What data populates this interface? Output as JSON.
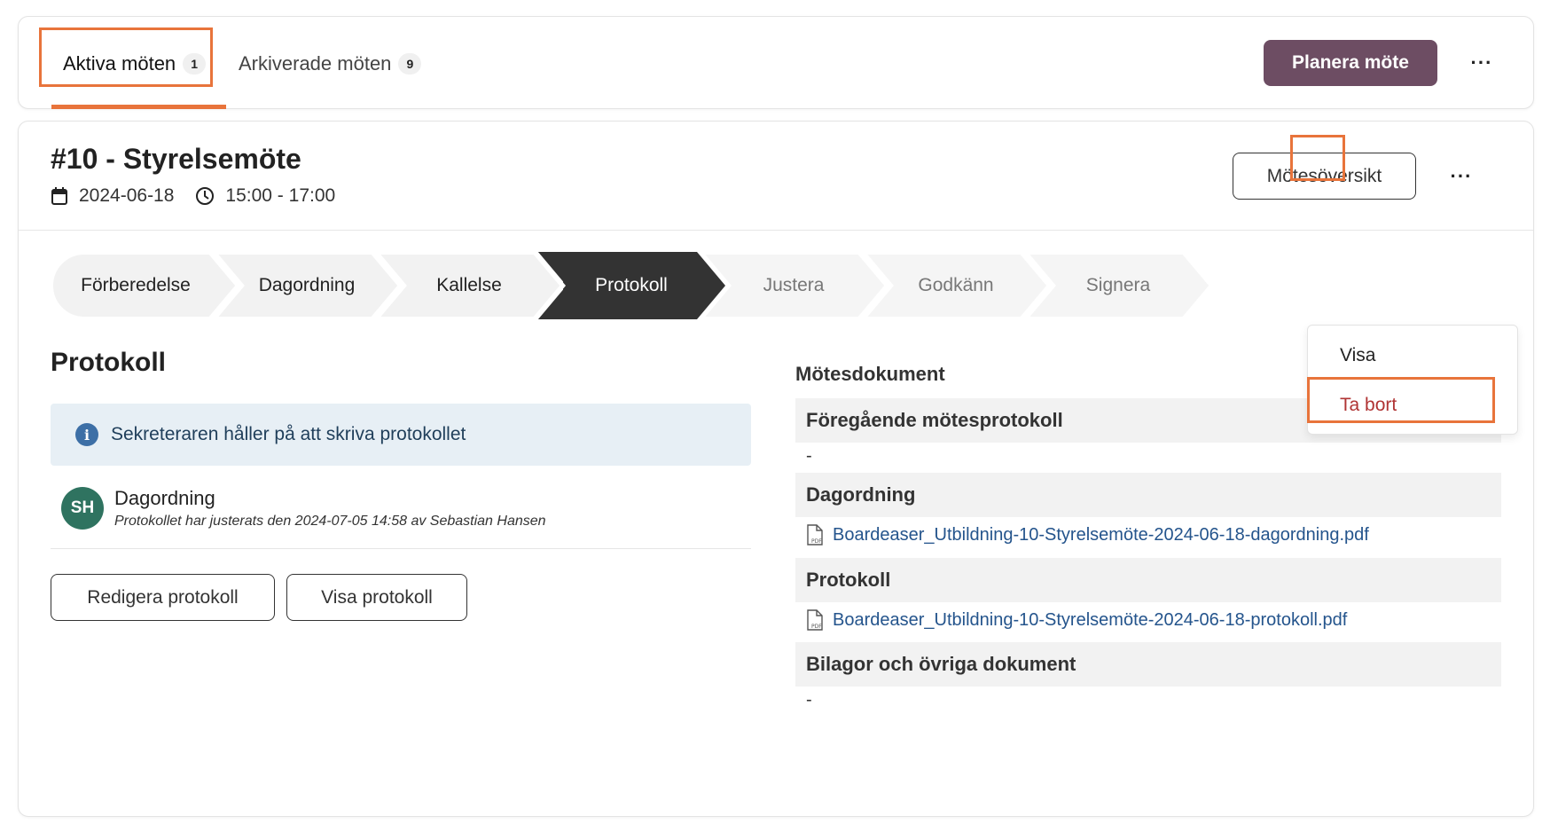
{
  "tabs": [
    {
      "label": "Aktiva möten",
      "count": "1"
    },
    {
      "label": "Arkiverade möten",
      "count": "9"
    }
  ],
  "toolbar": {
    "plan_label": "Planera möte",
    "more_label": "···"
  },
  "meeting": {
    "title": "#10 - Styrelsemöte",
    "date": "2024-06-18",
    "time": "15:00 - 17:00",
    "overview_label": "Mötesöversikt",
    "more_label": "···"
  },
  "steps": [
    {
      "label": "Förberedelse",
      "state": "done"
    },
    {
      "label": "Dagordning",
      "state": "done"
    },
    {
      "label": "Kallelse",
      "state": "done"
    },
    {
      "label": "Protokoll",
      "state": "current"
    },
    {
      "label": "Justera",
      "state": "todo"
    },
    {
      "label": "Godkänn",
      "state": "todo"
    },
    {
      "label": "Signera",
      "state": "todo"
    }
  ],
  "dropdown": {
    "view_label": "Visa",
    "delete_label": "Ta bort"
  },
  "section": {
    "title": "Protokoll",
    "info": "Sekreteraren håller på att skriva protokollet",
    "entry": {
      "avatar": "SH",
      "title": "Dagordning",
      "subtitle": "Protokollet har justerats den 2024-07-05 14:58 av Sebastian Hansen"
    },
    "edit_label": "Redigera protokoll",
    "view_label": "Visa protokoll"
  },
  "documents": {
    "title": "Mötesdokument",
    "groups": [
      {
        "heading": "Föregående mötesprotokoll",
        "item": "-"
      },
      {
        "heading": "Dagordning",
        "item": "Boardeaser_Utbildning-10-Styrelsemöte-2024-06-18-dagordning.pdf"
      },
      {
        "heading": "Protokoll",
        "item": "Boardeaser_Utbildning-10-Styrelsemöte-2024-06-18-protokoll.pdf"
      },
      {
        "heading": "Bilagor och övriga dokument",
        "item": "-"
      }
    ]
  },
  "colors": {
    "accent_highlight": "#e8743b",
    "primary_button": "#6d4d63",
    "step_current": "#333333",
    "step_done": "#f2f2f2",
    "danger_text": "#b03434",
    "link": "#24548c",
    "avatar": "#2f7360",
    "info_bg": "#e7eff5"
  }
}
